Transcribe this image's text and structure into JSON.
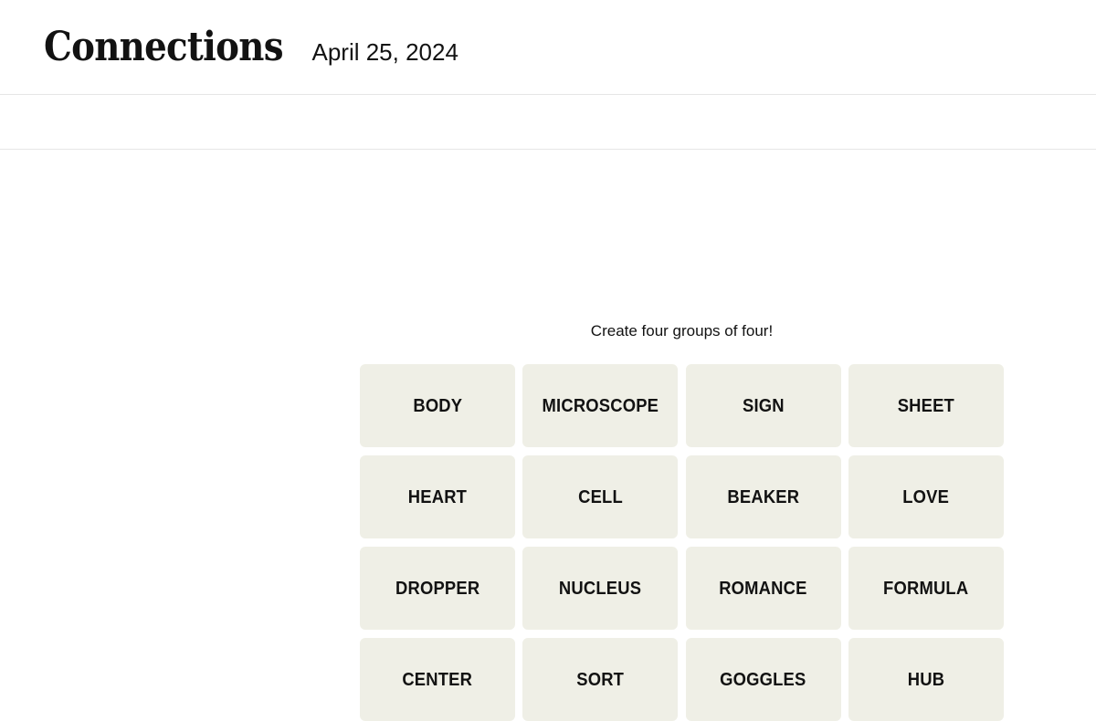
{
  "header": {
    "title": "Connections",
    "date": "April 25, 2024"
  },
  "toolbar": {
    "items": []
  },
  "main": {
    "instruction": "Create four groups of four!",
    "grid": {
      "rows": 4,
      "columns": 4,
      "tile_color": "#EFEFE6",
      "text_color": "#121212",
      "tiles": [
        {
          "label": "BODY"
        },
        {
          "label": "MICROSCOPE"
        },
        {
          "label": "SIGN"
        },
        {
          "label": "SHEET"
        },
        {
          "label": "HEART"
        },
        {
          "label": "CELL"
        },
        {
          "label": "BEAKER"
        },
        {
          "label": "LOVE"
        },
        {
          "label": "DROPPER"
        },
        {
          "label": "NUCLEUS"
        },
        {
          "label": "ROMANCE"
        },
        {
          "label": "FORMULA"
        },
        {
          "label": "CENTER"
        },
        {
          "label": "SORT"
        },
        {
          "label": "GOGGLES"
        },
        {
          "label": "HUB"
        }
      ]
    }
  },
  "colors": {
    "page_background": "#FFFFFF",
    "rule": "#E6E6E6",
    "tile": "#EFEFE6",
    "text": "#121212"
  }
}
